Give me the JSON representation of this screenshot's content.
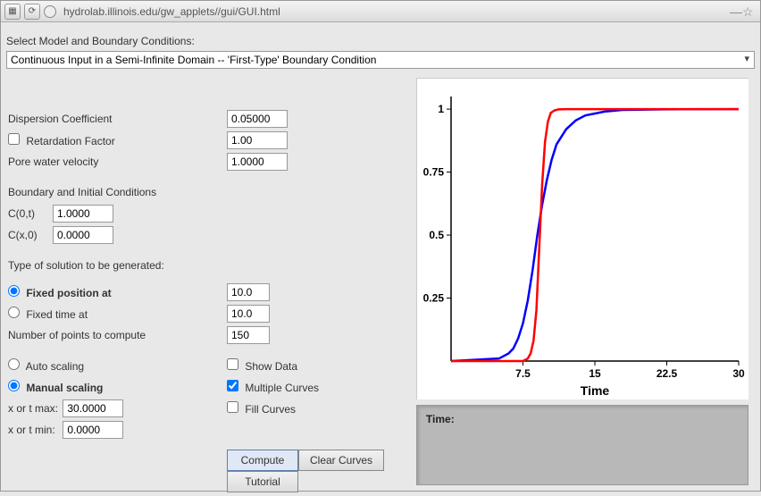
{
  "address_bar": {
    "url": "hydrolab.illinois.edu/gw_applets//gui/GUI.html"
  },
  "model": {
    "label": "Select Model and Boundary Conditions:",
    "selected": "Continuous Input in a Semi-Infinite Domain -- 'First-Type' Boundary Condition"
  },
  "params": {
    "dispersion_label": "Dispersion Coefficient",
    "dispersion_value": "0.05000",
    "retardation_label": "Retardation Factor",
    "retardation_value": "1.00",
    "retardation_checked": false,
    "velocity_label": "Pore water velocity",
    "velocity_value": "1.0000"
  },
  "bc": {
    "heading": "Boundary and Initial Conditions",
    "c0t_label": "C(0,t)",
    "c0t_value": "1.0000",
    "cx0_label": "C(x,0)",
    "cx0_value": "0.0000"
  },
  "solution": {
    "heading": "Type of solution to be generated:",
    "fixed_pos_label": "Fixed position at",
    "fixed_pos_value": "10.0",
    "fixed_time_label": "Fixed time at",
    "fixed_time_value": "10.0",
    "selected": "fixed_pos",
    "npoints_label": "Number of points to compute",
    "npoints_value": "150"
  },
  "scaling": {
    "auto_label": "Auto scaling",
    "manual_label": "Manual scaling",
    "selected": "manual",
    "xmax_label": "x or t max:",
    "xmax_value": "30.0000",
    "xmin_label": "x or t min:",
    "xmin_value": "0.0000"
  },
  "options": {
    "show_data_label": "Show Data",
    "show_data_checked": false,
    "multi_label": "Multiple Curves",
    "multi_checked": true,
    "fill_label": "Fill Curves",
    "fill_checked": false
  },
  "buttons": {
    "compute": "Compute",
    "clear": "Clear Curves",
    "tutorial": "Tutorial"
  },
  "status": {
    "time_label": "Time:"
  },
  "chart_data": {
    "type": "line",
    "xlabel": "Time",
    "ylabel": "",
    "xlim": [
      0,
      30
    ],
    "ylim": [
      0,
      1.05
    ],
    "x_ticks": [
      7.5,
      15,
      22.5,
      30
    ],
    "y_ticks": [
      0.25,
      0.5,
      0.75,
      1
    ],
    "series": [
      {
        "name": "blue",
        "color": "#0000ff",
        "x": [
          0,
          5.0,
          6.0,
          6.5,
          7.0,
          7.5,
          8.0,
          8.5,
          9.0,
          9.5,
          10.0,
          10.5,
          11.0,
          12.0,
          13.0,
          14.0,
          16.0,
          18.0,
          22.0,
          30.0
        ],
        "values": [
          0,
          0.01,
          0.03,
          0.05,
          0.09,
          0.15,
          0.24,
          0.36,
          0.5,
          0.62,
          0.72,
          0.8,
          0.86,
          0.92,
          0.955,
          0.975,
          0.99,
          0.997,
          0.999,
          1.0
        ]
      },
      {
        "name": "red",
        "color": "#ff0000",
        "x": [
          0,
          7.0,
          7.5,
          8.0,
          8.3,
          8.6,
          8.9,
          9.2,
          9.5,
          9.8,
          10.1,
          10.4,
          10.8,
          11.2,
          12.0,
          30.0
        ],
        "values": [
          0,
          0.0,
          0.0,
          0.01,
          0.03,
          0.08,
          0.2,
          0.45,
          0.7,
          0.87,
          0.95,
          0.985,
          0.995,
          0.999,
          1.0,
          1.0
        ]
      }
    ]
  }
}
